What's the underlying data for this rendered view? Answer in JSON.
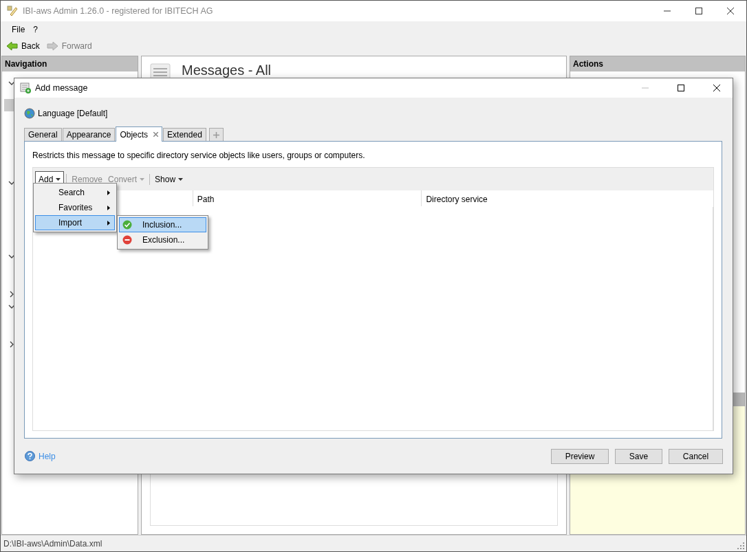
{
  "window": {
    "title": "IBI-aws Admin 1.26.0 - registered for IBITECH AG"
  },
  "menu": [
    {
      "label": "File"
    },
    {
      "label": "?"
    }
  ],
  "toolbar": [
    {
      "label": "Back",
      "kind": "back",
      "disabled": false
    },
    {
      "label": "Forward",
      "kind": "forward",
      "disabled": true
    }
  ],
  "navigation": {
    "title": "Navigation"
  },
  "content": {
    "title": "Messages - All"
  },
  "actions": {
    "title": "Actions"
  },
  "dialog": {
    "title": "Add message",
    "language": "Language [Default]",
    "tabs": [
      {
        "label": "General",
        "selected": false,
        "closable": false
      },
      {
        "label": "Appearance",
        "selected": false,
        "closable": false
      },
      {
        "label": "Objects",
        "selected": true,
        "closable": true
      },
      {
        "label": "Extended",
        "selected": false,
        "closable": false
      }
    ],
    "description": "Restricts this message to specific directory service objects like users, groups or computers.",
    "list_toolbar": [
      {
        "label": "Add",
        "dropdown": true,
        "disabled": false,
        "separator_before": false
      },
      {
        "label": "Remove",
        "dropdown": false,
        "disabled": true,
        "separator_before": true
      },
      {
        "label": "Convert",
        "dropdown": true,
        "disabled": true,
        "separator_before": false
      },
      {
        "label": "Show",
        "dropdown": true,
        "disabled": false,
        "separator_before": true
      }
    ],
    "columns": [
      "Path",
      "Directory service"
    ],
    "add_menu": [
      {
        "label": "Search",
        "selected": false
      },
      {
        "label": "Favorites",
        "selected": false
      },
      {
        "label": "Import",
        "selected": true
      }
    ],
    "import_submenu": [
      {
        "label": "Inclusion...",
        "kind": "include",
        "selected": true
      },
      {
        "label": "Exclusion...",
        "kind": "exclude",
        "selected": false
      }
    ],
    "help": "Help",
    "buttons": [
      "Preview",
      "Save",
      "Cancel"
    ]
  },
  "status_bar": {
    "text": "D:\\IBI-aws\\Admin\\Data.xml"
  }
}
